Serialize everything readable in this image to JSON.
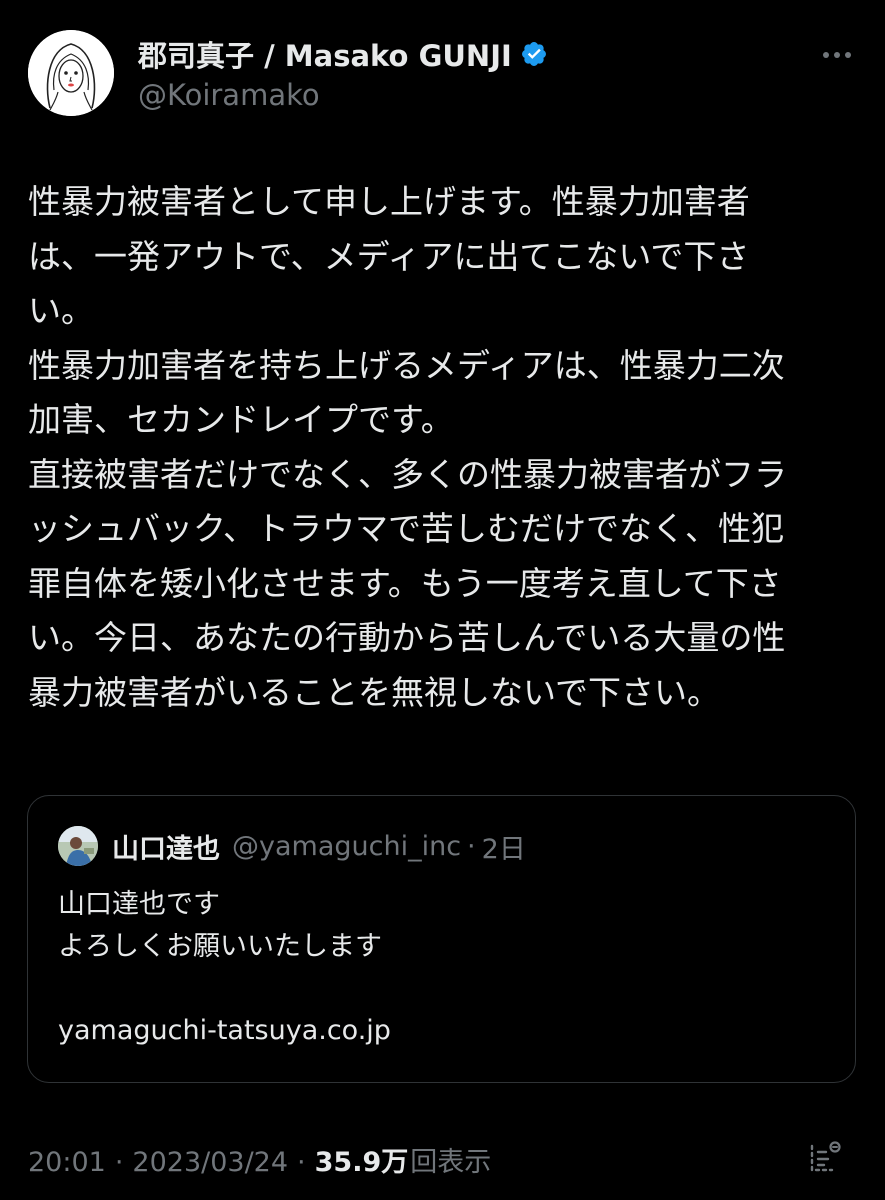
{
  "author": {
    "display_name": "郡司真子 / Masako GUNJI",
    "handle": "@Koiramako",
    "verified": true
  },
  "tweet": {
    "lines": [
      "性暴力被害者として申し上げます。性暴力加害者",
      "は、一発アウトで、メディアに出てこないで下さ",
      "い。",
      "性暴力加害者を持ち上げるメディアは、性暴力二次",
      "加害、セカンドレイプです。",
      "直接被害者だけでなく、多くの性暴力被害者がフラ",
      "ッシュバック、トラウマで苦しむだけでなく、性犯",
      "罪自体を矮小化させます。もう一度考え直して下さ",
      "い。今日、あなたの行動から苦しんでいる大量の性",
      "暴力被害者がいることを無視しないで下さい。"
    ]
  },
  "quoted_tweet": {
    "display_name": "山口達也",
    "handle": "@yamaguchi_inc",
    "separator": "·",
    "time": "2日",
    "lines": [
      "山口達也です",
      "よろしくお願いいたします",
      "",
      "yamaguchi-tatsuya.co.jp"
    ]
  },
  "meta": {
    "time": "20:01",
    "separator": "·",
    "date": "2023/03/24",
    "views_count": "35.9万",
    "views_label": "回表示"
  },
  "icons": {
    "more": "more-horizontal-icon",
    "verified": "verified-badge-icon",
    "analytics": "analytics-icon"
  },
  "colors": {
    "background": "#000000",
    "text_primary": "#e7e9ea",
    "text_secondary": "#71767b",
    "border": "#2f3336",
    "verified_blue": "#1d9bf0"
  }
}
